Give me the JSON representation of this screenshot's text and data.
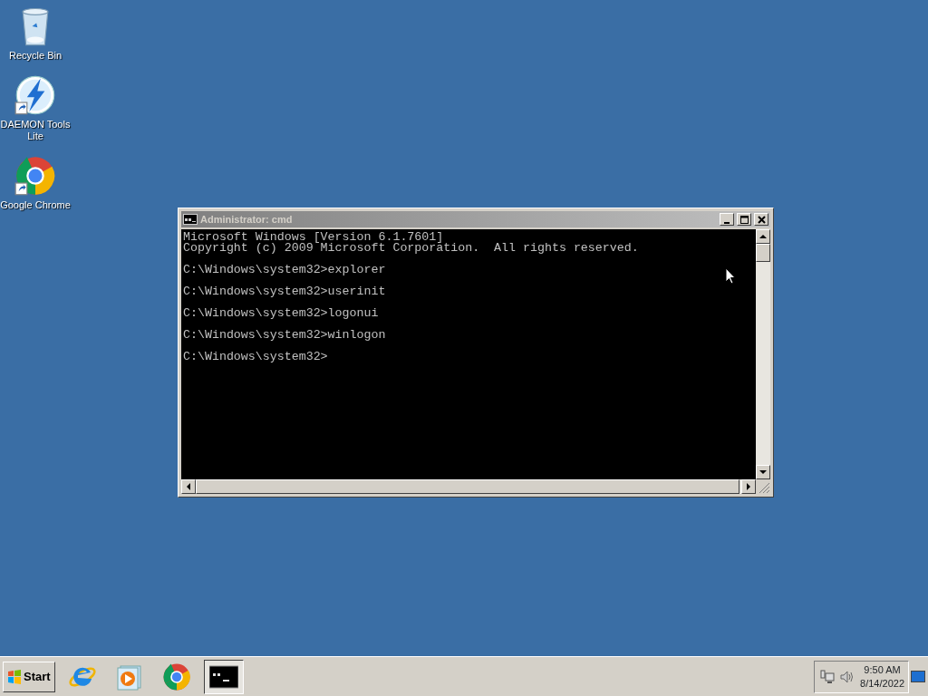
{
  "desktop_icons": [
    {
      "kind": "recycle",
      "label": "Recycle Bin"
    },
    {
      "kind": "daemon",
      "label": "DAEMON Tools Lite"
    },
    {
      "kind": "chrome",
      "label": "Google Chrome"
    }
  ],
  "window": {
    "title": "Administrator: cmd",
    "active": false,
    "console_blocks": [
      [
        "Microsoft Windows [Version 6.1.7601]",
        "Copyright (c) 2009 Microsoft Corporation.  All rights reserved."
      ],
      [
        "C:\\Windows\\system32>explorer"
      ],
      [
        "C:\\Windows\\system32>userinit"
      ],
      [
        "C:\\Windows\\system32>logonui"
      ],
      [
        "C:\\Windows\\system32>winlogon"
      ],
      [
        "C:\\Windows\\system32>"
      ]
    ]
  },
  "taskbar": {
    "start_label": "Start",
    "items": [
      {
        "kind": "ie",
        "selected": false
      },
      {
        "kind": "media",
        "selected": false
      },
      {
        "kind": "chrome",
        "selected": false
      },
      {
        "kind": "cmd",
        "selected": true
      }
    ],
    "clock": {
      "time": "9:50 AM",
      "date": "8/14/2022"
    }
  }
}
